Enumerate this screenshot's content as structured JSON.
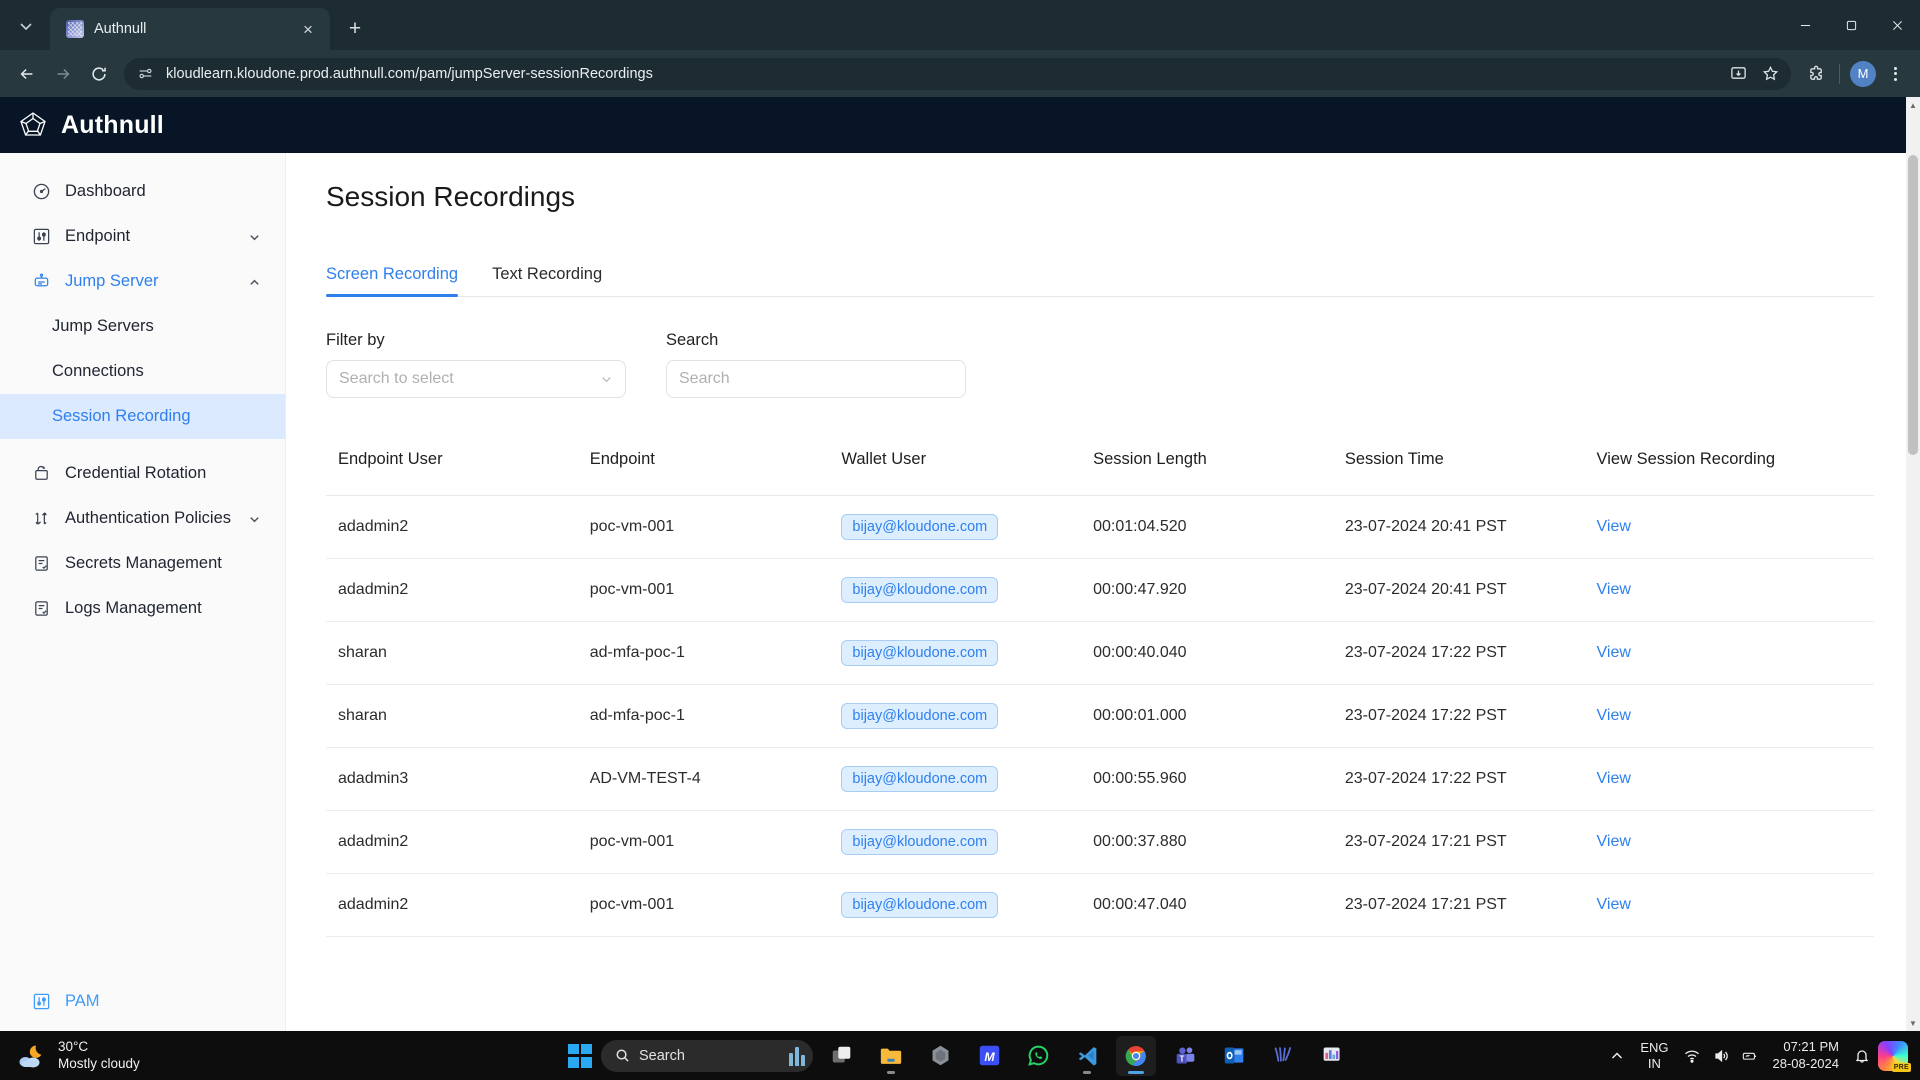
{
  "browser": {
    "tab": {
      "title": "Authnull",
      "close_label": "×",
      "favicon": "authnull-favicon"
    },
    "new_tab_label": "+",
    "url": "kloudlearn.kloudone.prod.authnull.com/pam/jumpServer-sessionRecordings",
    "profile_initial": "M",
    "window_controls": {
      "minimize": "minimize-icon",
      "maximize": "maximize-icon",
      "close": "close-icon"
    }
  },
  "app": {
    "brand": "Authnull",
    "sidebar": {
      "items": [
        {
          "label": "Dashboard",
          "icon": "gauge-icon",
          "type": "item",
          "active": false,
          "expandable": false
        },
        {
          "label": "Endpoint",
          "icon": "sliders-icon",
          "type": "item",
          "active": false,
          "expandable": true
        },
        {
          "label": "Jump Server",
          "icon": "jumpserver-icon",
          "type": "item",
          "active": true,
          "expandable": true
        }
      ],
      "subitems": [
        {
          "label": "Jump Servers",
          "selected": false
        },
        {
          "label": "Connections",
          "selected": false
        },
        {
          "label": "Session Recording",
          "selected": true
        }
      ],
      "items_after": [
        {
          "label": "Credential Rotation",
          "icon": "rotate-icon",
          "expandable": false
        },
        {
          "label": "Authentication Policies",
          "icon": "policies-icon",
          "expandable": true
        },
        {
          "label": "Secrets Management",
          "icon": "secrets-icon",
          "expandable": false
        },
        {
          "label": "Logs Management",
          "icon": "logs-icon",
          "expandable": false
        }
      ],
      "footer": {
        "label": "PAM",
        "icon": "sliders-icon"
      }
    },
    "page": {
      "title": "Session Recordings",
      "tabs": [
        {
          "label": "Screen Recording",
          "active": true
        },
        {
          "label": "Text Recording",
          "active": false
        }
      ],
      "filter": {
        "label": "Filter by",
        "placeholder": "Search to select",
        "value": ""
      },
      "search": {
        "label": "Search",
        "placeholder": "Search",
        "value": ""
      },
      "table": {
        "columns": [
          "Endpoint User",
          "Endpoint",
          "Wallet User",
          "Session Length",
          "Session Time",
          "View Session Recording"
        ],
        "rows": [
          {
            "endpoint_user": "adadmin2",
            "endpoint": "poc-vm-001",
            "wallet_user": "bijay@kloudone.com",
            "session_length": "00:01:04.520",
            "session_time": "23-07-2024 20:41 PST",
            "action": "View"
          },
          {
            "endpoint_user": "adadmin2",
            "endpoint": "poc-vm-001",
            "wallet_user": "bijay@kloudone.com",
            "session_length": "00:00:47.920",
            "session_time": "23-07-2024 20:41 PST",
            "action": "View"
          },
          {
            "endpoint_user": "sharan",
            "endpoint": "ad-mfa-poc-1",
            "wallet_user": "bijay@kloudone.com",
            "session_length": "00:00:40.040",
            "session_time": "23-07-2024 17:22 PST",
            "action": "View"
          },
          {
            "endpoint_user": "sharan",
            "endpoint": "ad-mfa-poc-1",
            "wallet_user": "bijay@kloudone.com",
            "session_length": "00:00:01.000",
            "session_time": "23-07-2024 17:22 PST",
            "action": "View"
          },
          {
            "endpoint_user": "adadmin3",
            "endpoint": "AD-VM-TEST-4",
            "wallet_user": "bijay@kloudone.com",
            "session_length": "00:00:55.960",
            "session_time": "23-07-2024 17:22 PST",
            "action": "View"
          },
          {
            "endpoint_user": "adadmin2",
            "endpoint": "poc-vm-001",
            "wallet_user": "bijay@kloudone.com",
            "session_length": "00:00:37.880",
            "session_time": "23-07-2024 17:21 PST",
            "action": "View"
          },
          {
            "endpoint_user": "adadmin2",
            "endpoint": "poc-vm-001",
            "wallet_user": "bijay@kloudone.com",
            "session_length": "00:00:47.040",
            "session_time": "23-07-2024 17:21 PST",
            "action": "View"
          }
        ]
      }
    }
  },
  "taskbar": {
    "weather": {
      "temperature": "30°C",
      "condition": "Mostly cloudy",
      "icon": "moon-cloud-icon"
    },
    "search_placeholder": "Search",
    "apps": [
      {
        "name": "task-view-icon",
        "running": false
      },
      {
        "name": "file-explorer-icon",
        "running": true
      },
      {
        "name": "copilot-app-icon",
        "running": false
      },
      {
        "name": "m-app-icon",
        "running": false
      },
      {
        "name": "whatsapp-icon",
        "running": false
      },
      {
        "name": "vscode-icon",
        "running": true
      },
      {
        "name": "chrome-icon",
        "running": true
      },
      {
        "name": "teams-icon",
        "running": false
      },
      {
        "name": "outlook-icon",
        "running": false
      },
      {
        "name": "wails-icon",
        "running": false
      },
      {
        "name": "screenshot-app-icon",
        "running": false
      }
    ],
    "language": {
      "line1": "ENG",
      "line2": "IN"
    },
    "clock": {
      "time": "07:21 PM",
      "date": "28-08-2024"
    },
    "tray": [
      "chevron-up-icon",
      "wifi-icon",
      "volume-icon",
      "battery-icon",
      "notification-bell-icon"
    ],
    "copilot_badge": "PRE"
  },
  "colors": {
    "accent": "#2f80ed",
    "appbar": "#071527",
    "chrome": "#28383f",
    "chrome_dark": "#1d2b32",
    "selected_nav": "#dbeafe",
    "pill_bg": "#ddeeff",
    "pill_border": "#a8cdf5"
  }
}
